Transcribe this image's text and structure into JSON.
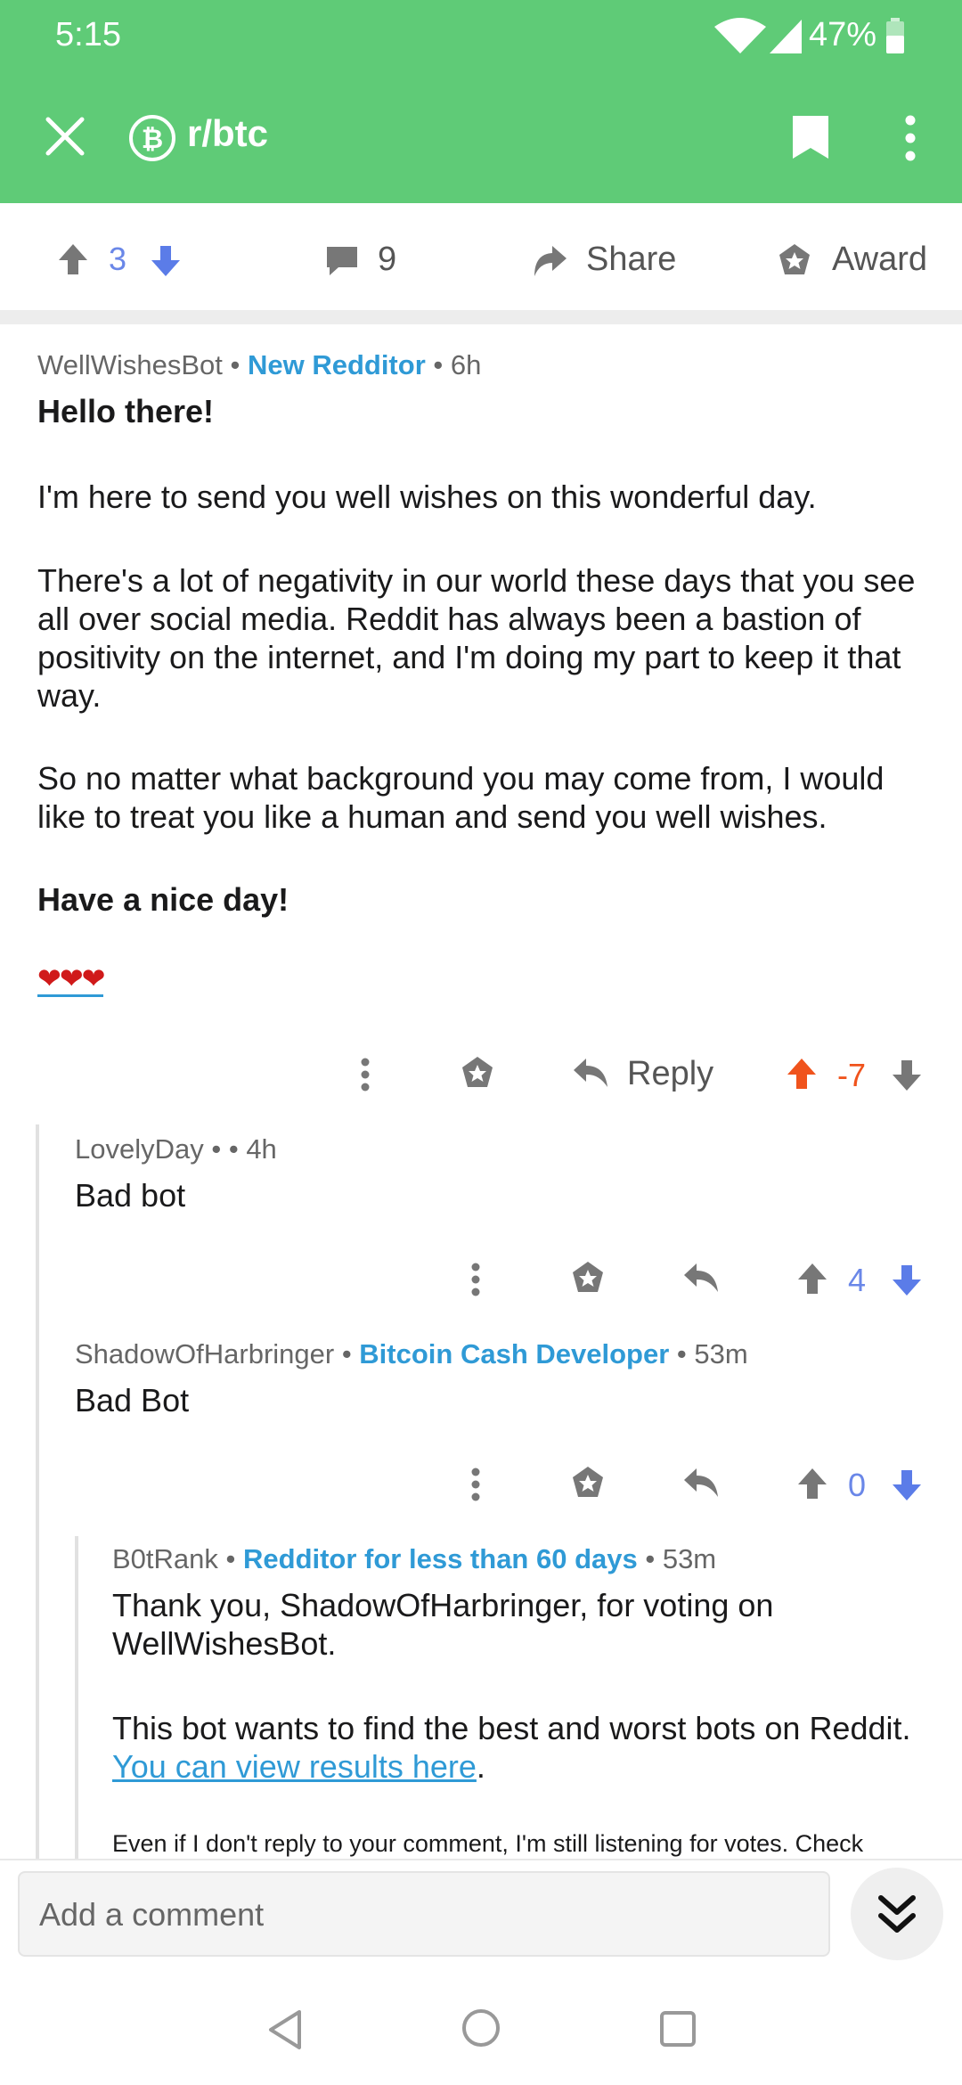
{
  "status_bar": {
    "time": "5:15",
    "battery": "47%"
  },
  "app_bar": {
    "subreddit": "r/btc"
  },
  "post_actions": {
    "score": "3",
    "comments": "9",
    "share_label": "Share",
    "award_label": "Award"
  },
  "comments": [
    {
      "author": "WellWishesBot",
      "flair": "New Redditor",
      "age": "6h",
      "paragraphs": [
        "Hello there!",
        "I'm here to send you well wishes on this wonderful day.",
        "There's a lot of negativity in our world these days that you see all over social media. Reddit has always been a bastion of positivity on the internet, and I'm doing my part to keep it that way.",
        "So no matter what background you may come from, I would like to treat you like a human and send you well wishes.",
        "Have a nice day!",
        "❤❤❤"
      ],
      "reply_label": "Reply",
      "score": "-7"
    },
    {
      "author": "LovelyDay",
      "flair": "",
      "age": "4h",
      "body": "Bad bot",
      "score": "4"
    },
    {
      "author": "ShadowOfHarbringer",
      "flair": "Bitcoin Cash Developer",
      "age": "53m",
      "body": "Bad Bot",
      "score": "0"
    },
    {
      "author": "B0tRank",
      "flair": "Redditor for less than 60 days",
      "age": "53m",
      "paragraphs": [
        "Thank you, ShadowOfHarbringer, for voting on WellWishesBot.",
        "This bot wants to find the best and worst bots on Reddit."
      ],
      "link_text": "You can view results here",
      "small_text": "Even if I don't reply to your comment, I'm still listening for votes. Check"
    }
  ],
  "composer": {
    "placeholder": "Add a comment"
  },
  "colors": {
    "app_bar": "#5fcb77",
    "flair": "#2f9ad6",
    "upvote_active": "#f0531c",
    "vote_blue": "#6a87e8",
    "icon_gray": "#777777"
  },
  "icons": {
    "close": "close-icon",
    "bitcoin": "bitcoin-icon",
    "bookmark": "bookmark-icon",
    "more": "more-vertical-icon",
    "upvote": "upvote-icon",
    "downvote": "downvote-icon",
    "comment": "comment-icon",
    "share": "share-icon",
    "award": "award-icon",
    "reply": "reply-icon",
    "collapse": "double-chevron-down-icon"
  }
}
